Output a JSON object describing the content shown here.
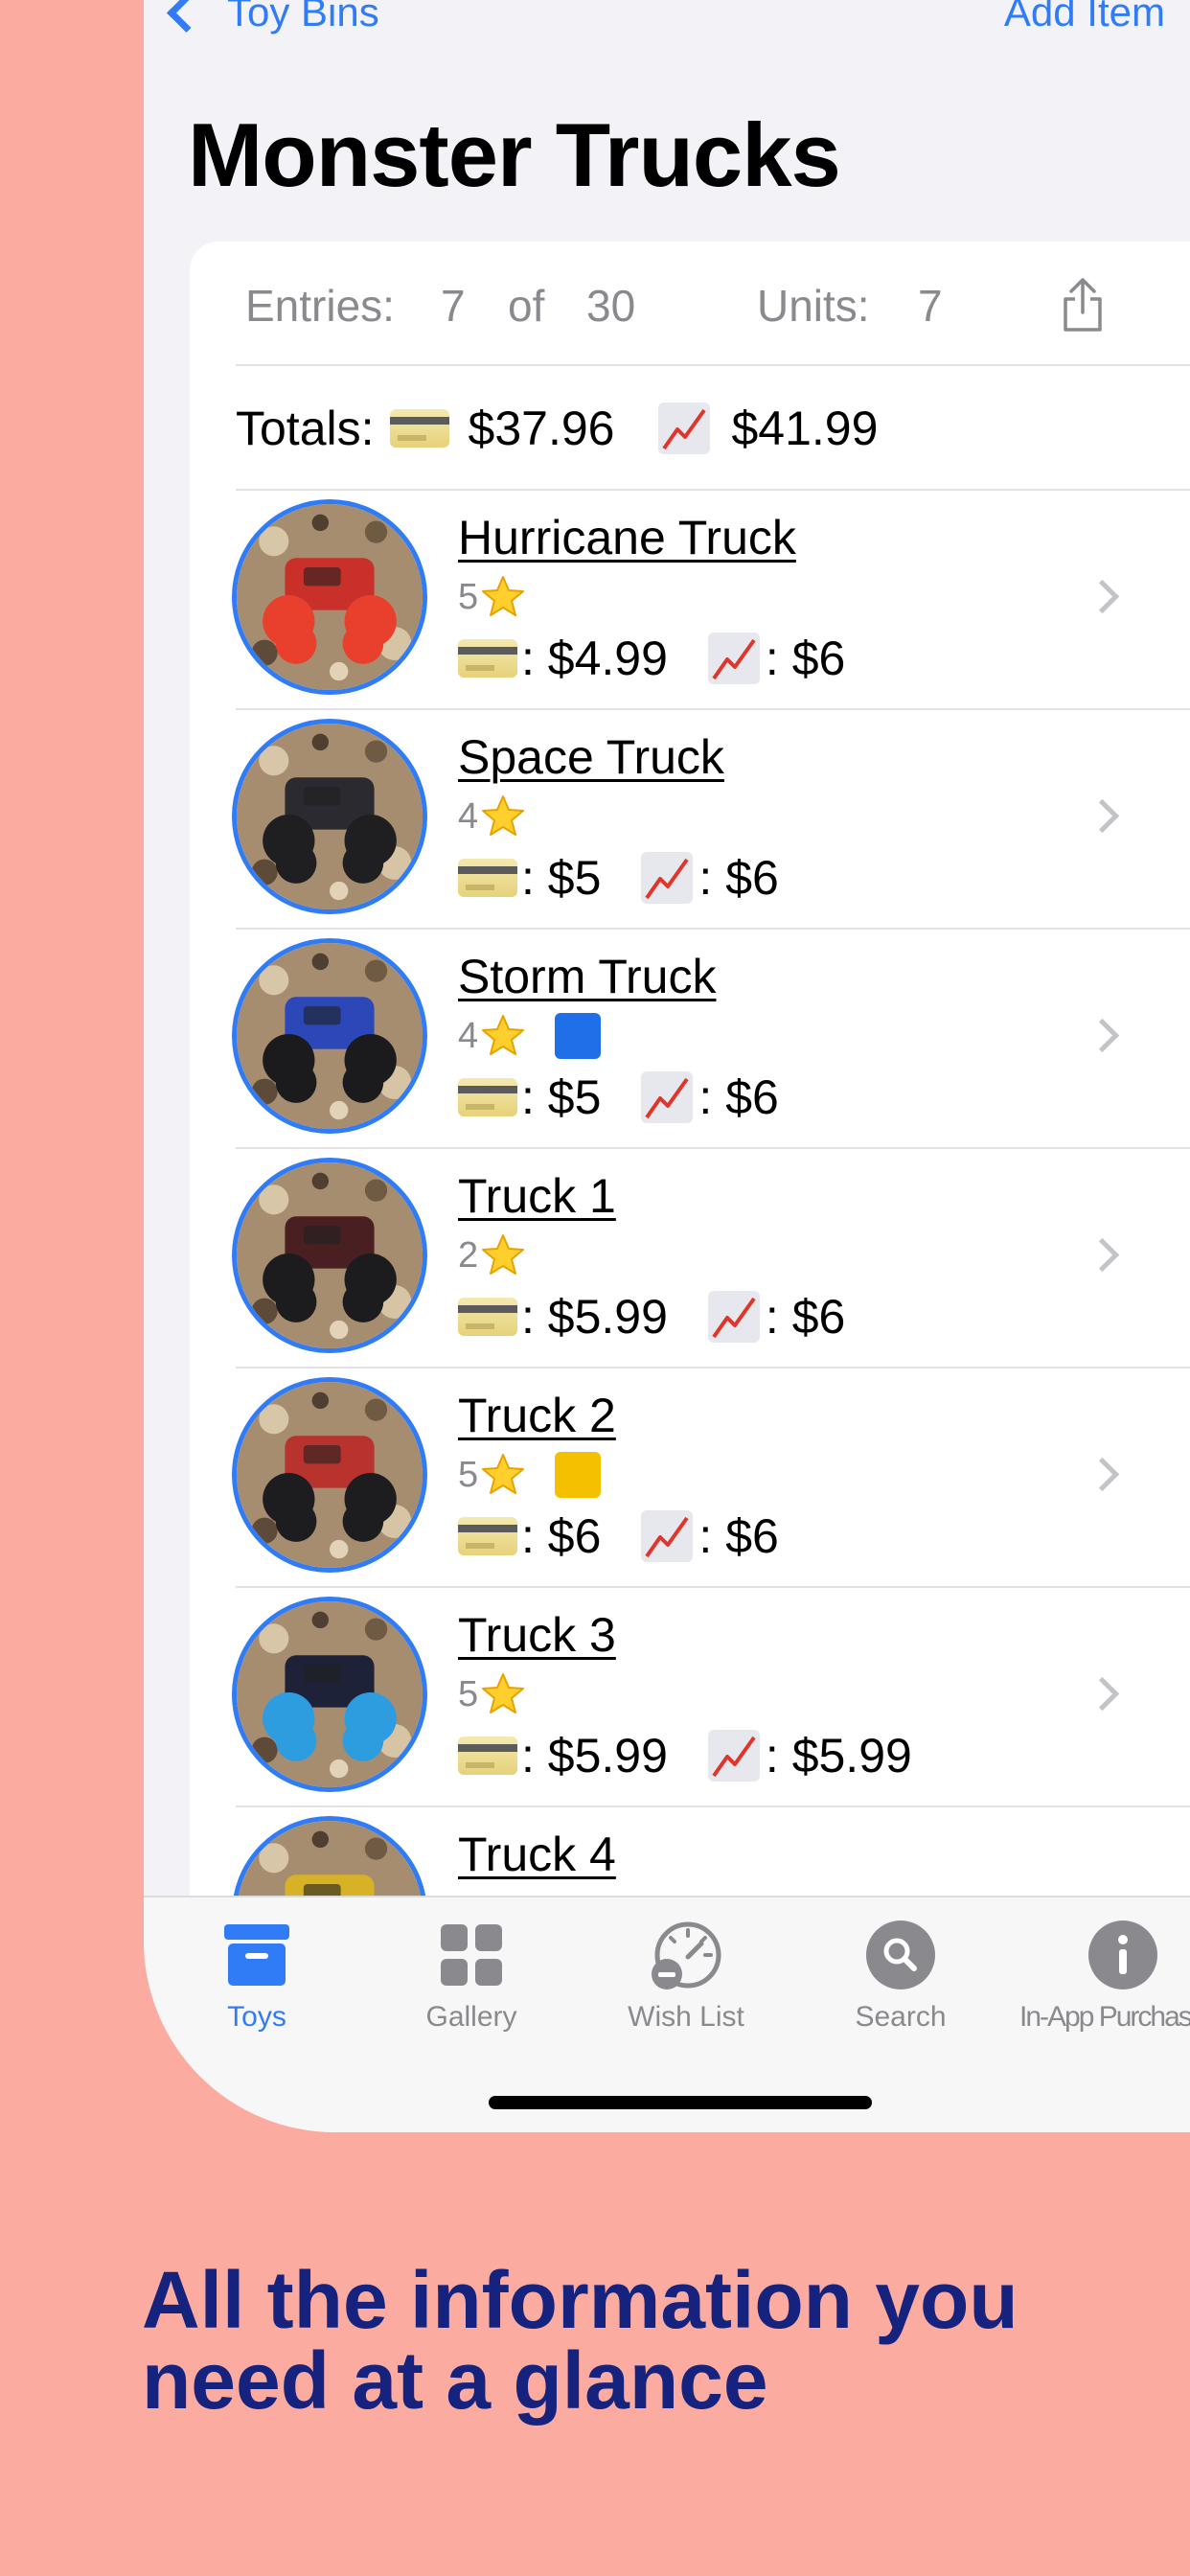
{
  "nav": {
    "back_label": "Toy Bins",
    "add_label": "Add Item"
  },
  "page_title": "Monster Trucks",
  "stats": {
    "entries_label": "Entries:",
    "entries_count": "7",
    "of_label": "of",
    "entries_total": "30",
    "units_label": "Units:",
    "units_count": "7"
  },
  "totals": {
    "label": "Totals:",
    "paid": "$37.96",
    "value": "$41.99"
  },
  "items": [
    {
      "name": "Hurricane Truck",
      "stars": "5",
      "tag_color": "",
      "paid": ": $4.99",
      "value": ": $6",
      "wheel_color": "#e8402c",
      "body_color": "#c9302a"
    },
    {
      "name": "Space Truck",
      "stars": "4",
      "tag_color": "",
      "paid": ": $5",
      "value": ": $6",
      "wheel_color": "#1f1f22",
      "body_color": "#2a2a30"
    },
    {
      "name": "Storm Truck",
      "stars": "4",
      "tag_color": "#1f6fe8",
      "paid": ": $5",
      "value": ": $6",
      "wheel_color": "#1b1b1e",
      "body_color": "#2b47b8"
    },
    {
      "name": "Truck 1",
      "stars": "2",
      "tag_color": "",
      "paid": ": $5.99",
      "value": ": $6",
      "wheel_color": "#1c1c1e",
      "body_color": "#4a1f22"
    },
    {
      "name": "Truck 2",
      "stars": "5",
      "tag_color": "#f4c000",
      "paid": ": $6",
      "value": ": $6",
      "wheel_color": "#1d1d20",
      "body_color": "#b8322e"
    },
    {
      "name": "Truck 3",
      "stars": "5",
      "tag_color": "",
      "paid": ": $5.99",
      "value": ": $5.99",
      "wheel_color": "#2d9de0",
      "body_color": "#1d2238"
    },
    {
      "name": "Truck 4",
      "stars": "",
      "tag_color": "",
      "paid": "",
      "value": "",
      "wheel_color": "#1d1d20",
      "body_color": "#d7b227"
    }
  ],
  "tabs": [
    {
      "label": "Toys",
      "icon": "archive-box-icon",
      "active": true
    },
    {
      "label": "Gallery",
      "icon": "grid-icon",
      "active": false
    },
    {
      "label": "Wish List",
      "icon": "gauge-icon",
      "active": false
    },
    {
      "label": "Search",
      "icon": "search-icon",
      "active": false
    },
    {
      "label": "In-App Purchase",
      "icon": "info-icon",
      "active": false
    }
  ],
  "caption": {
    "line1": "All the information you",
    "line2": "need at a glance"
  },
  "colors": {
    "accent": "#2f7cf6",
    "background": "#fbaba0",
    "caption": "#15237e"
  }
}
